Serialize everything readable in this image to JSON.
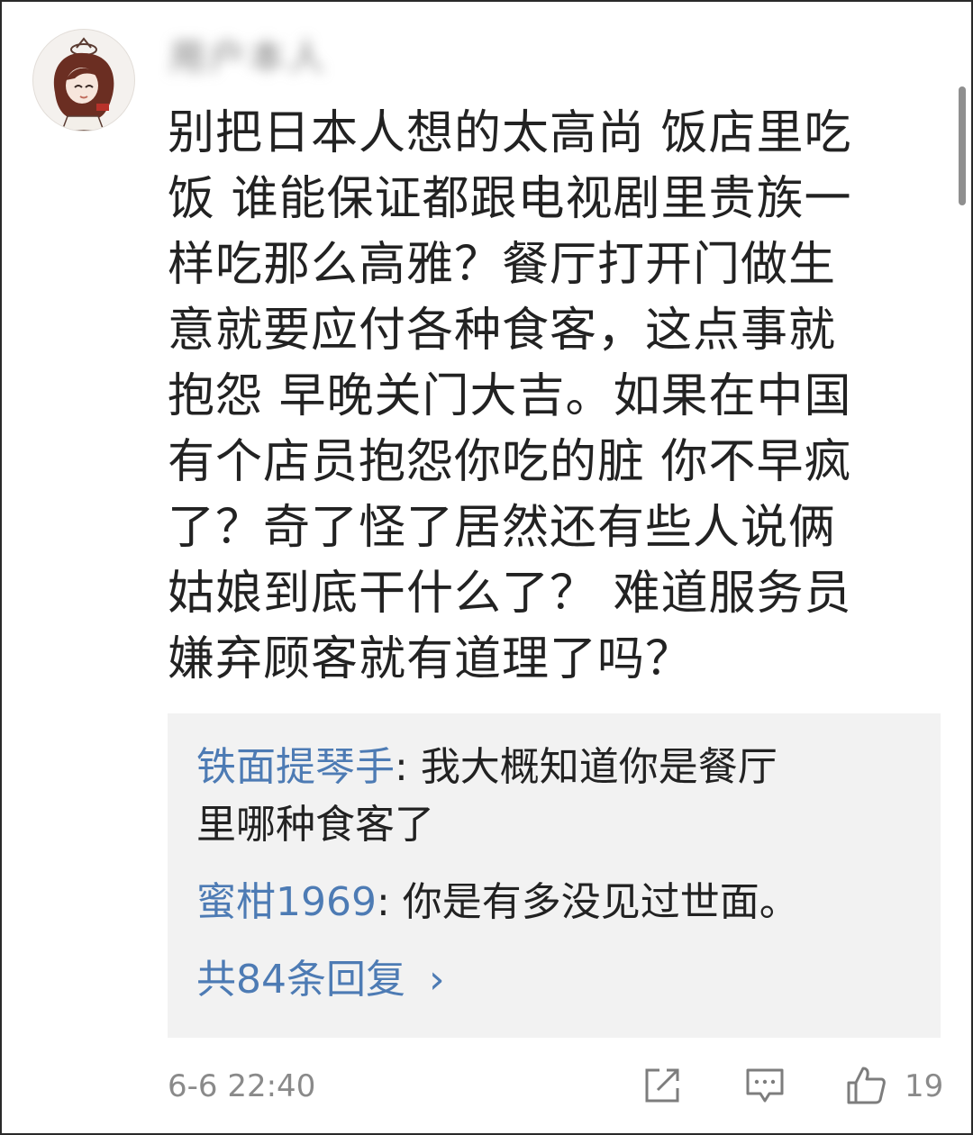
{
  "comment": {
    "username": "用户本人",
    "text": "别把日本人想的太高尚 饭店里吃\n饭 谁能保证都跟电视剧里贵族一\n样吃那么高雅？餐厅打开门做生\n意就要应付各种食客，这点事就\n抱怨 早晚关门大吉。如果在中国\n有个店员抱怨你吃的脏 你不早疯\n了？奇了怪了居然还有些人说俩\n姑娘到底干什么了？ 难道服务员\n嫌弃顾客就有道理了吗？",
    "time": "6-6 22:40",
    "like_count": "19"
  },
  "replies": [
    {
      "author": "铁面提琴手",
      "separator": ": ",
      "text": "我大概知道你是餐厅\n里哪种食客了"
    },
    {
      "author": "蜜柑1969",
      "separator": ": ",
      "text": "你是有多没见过世面。"
    }
  ],
  "reply_summary": {
    "label": "共84条回复",
    "chevron": "›"
  },
  "icons": [
    "avatar",
    "share-icon",
    "comment-icon",
    "like-icon"
  ],
  "colors": {
    "link": "#4d7bb4",
    "text": "#222222",
    "meta": "#8a8a8a",
    "reply_bg": "#f2f2f2"
  }
}
